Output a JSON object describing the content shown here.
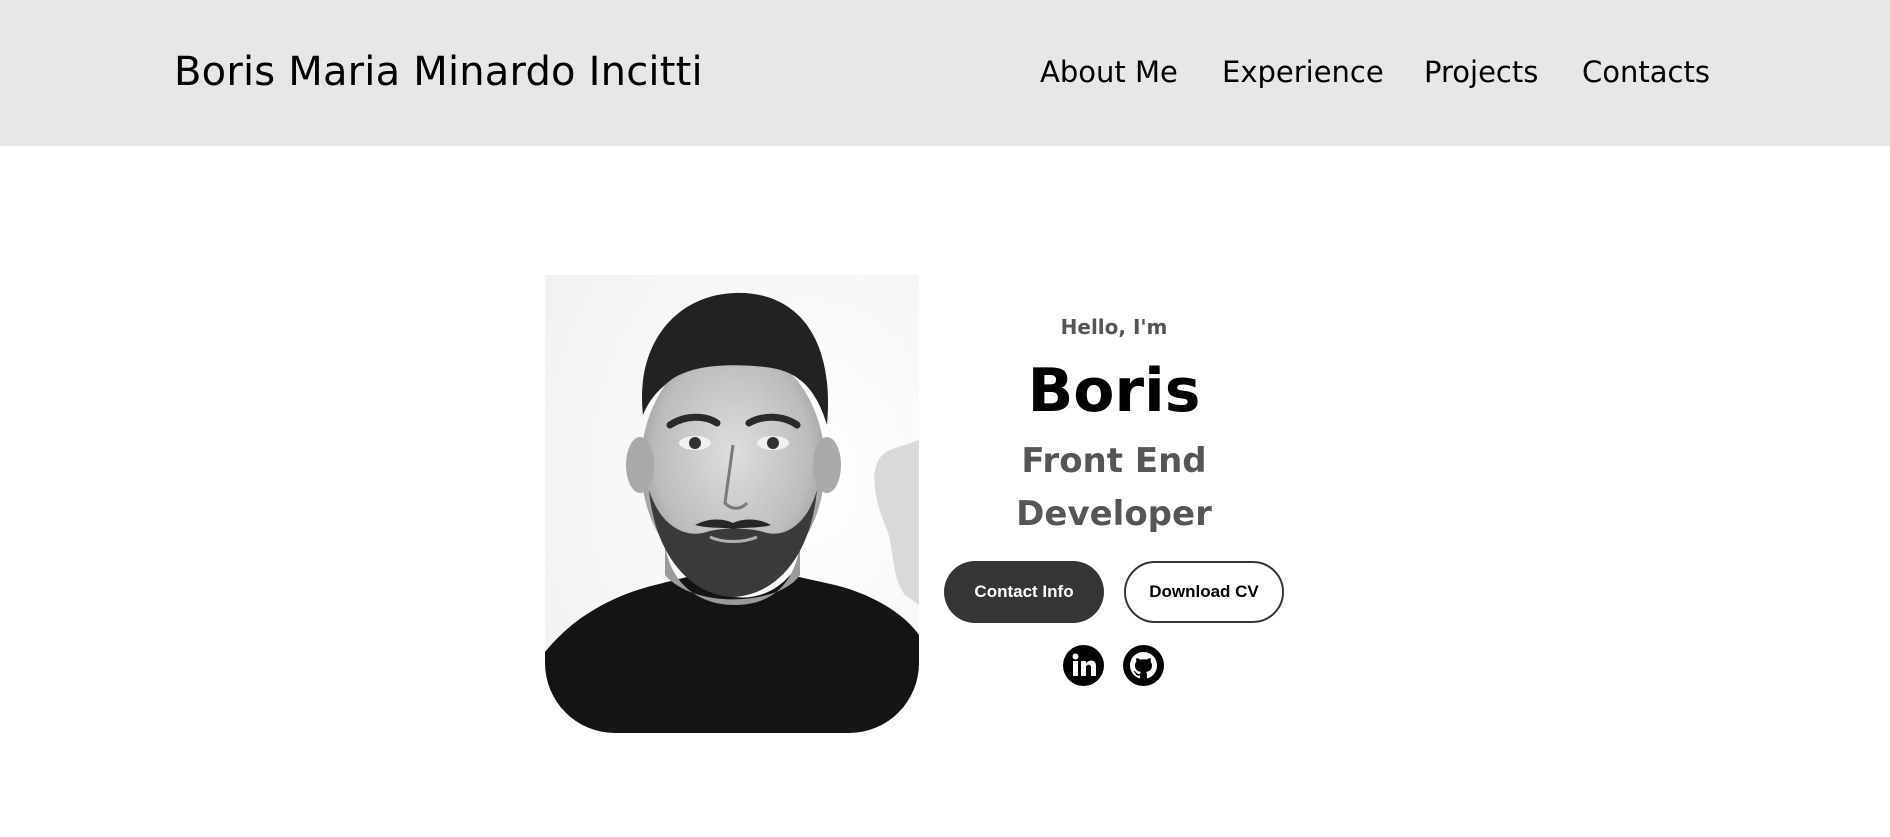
{
  "header": {
    "logo_text": "Boris Maria Minardo Incitti",
    "nav": [
      {
        "label": "About Me"
      },
      {
        "label": "Experience"
      },
      {
        "label": "Projects"
      },
      {
        "label": "Contacts"
      }
    ],
    "background": "#e7e7e7"
  },
  "hero": {
    "greeting": "Hello, I'm",
    "name": "Boris",
    "role": "Front End Developer",
    "buttons": {
      "contact": "Contact Info",
      "download": "Download CV"
    },
    "social": [
      {
        "icon": "linkedin-icon"
      },
      {
        "icon": "github-icon"
      }
    ],
    "colors": {
      "dark_button": "#353535",
      "subtitle": "#555555"
    }
  }
}
